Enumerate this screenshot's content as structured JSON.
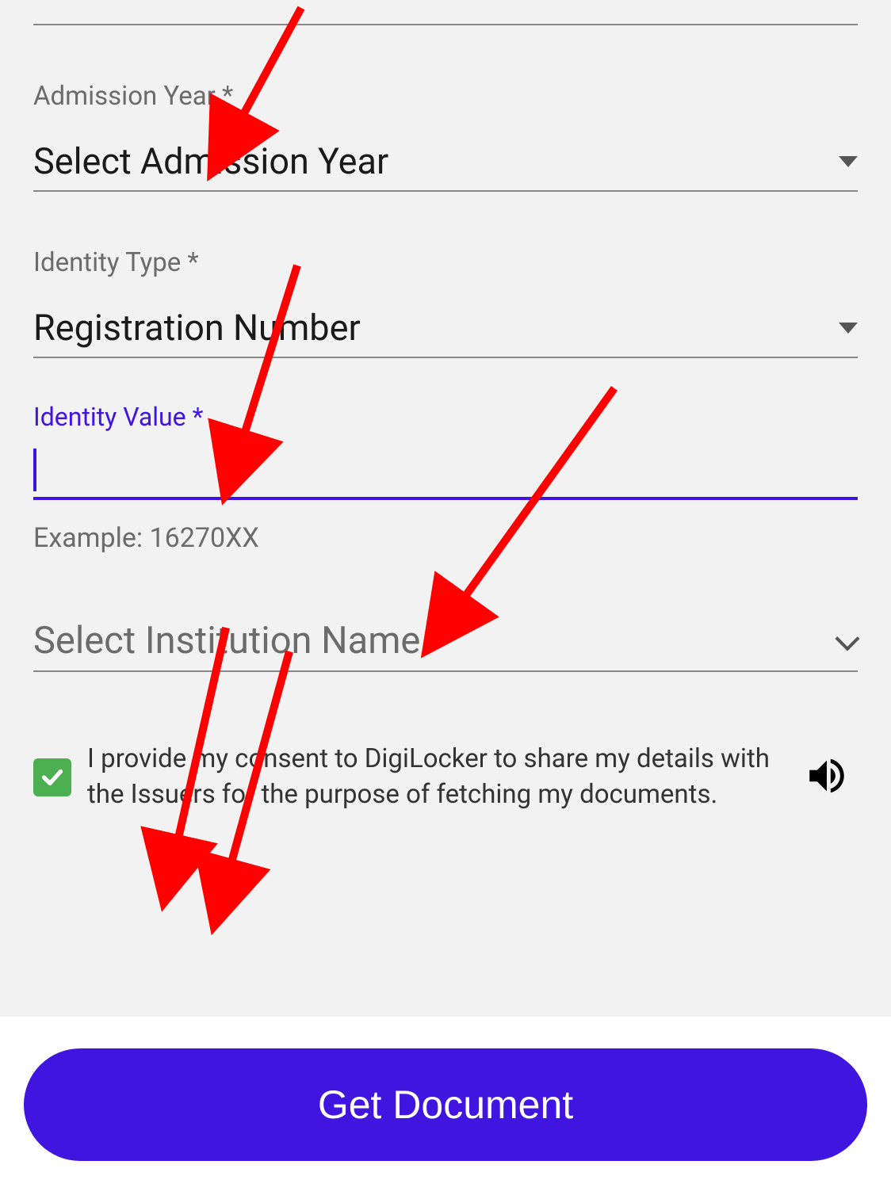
{
  "admissionYear": {
    "label": "Admission Year  *",
    "placeholder": "Select Admission Year"
  },
  "identityType": {
    "label": "Identity Type  *",
    "value": "Registration Number"
  },
  "identityValue": {
    "label": "Identity Value *",
    "helper": "Example: 16270XX"
  },
  "institution": {
    "placeholder": "Select Institution Name *"
  },
  "consent": {
    "text": "I provide my consent to DigiLocker to share my details with the Issuers for the purpose of fetching my documents.",
    "checked": true
  },
  "button": {
    "label": "Get Document"
  }
}
